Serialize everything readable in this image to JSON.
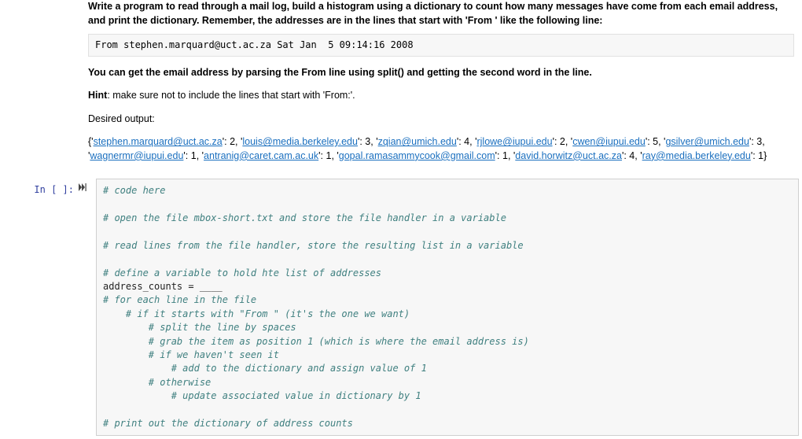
{
  "markdown": {
    "instruction_prefix_bold": "Write a program to read through a mail log, build a histogram using a dictionary to count how many messages have come from each email address, and print the dictionary. Remember, the addresses are in the lines that start with 'From ' like the following line:",
    "sample_line": "From stephen.marquard@uct.ac.za Sat Jan  5 09:14:16 2008",
    "parse_instruction": "You can get the email address by parsing the From line using split() and getting the second word in the line.",
    "hint_label": "Hint",
    "hint_text": ": make sure not to include the lines that start with 'From:'.",
    "desired_label": "Desired output:",
    "output_emails": [
      {
        "email": "stephen.marquard@uct.ac.za",
        "count": 2
      },
      {
        "email": "louis@media.berkeley.edu",
        "count": 3
      },
      {
        "email": "zqian@umich.edu",
        "count": 4
      },
      {
        "email": "rjlowe@iupui.edu",
        "count": 2
      },
      {
        "email": "cwen@iupui.edu",
        "count": 5
      },
      {
        "email": "gsilver@umich.edu",
        "count": 3
      },
      {
        "email": "wagnermr@iupui.edu",
        "count": 1
      },
      {
        "email": "antranig@caret.cam.ac.uk",
        "count": 1
      },
      {
        "email": "gopal.ramasammycook@gmail.com",
        "count": 1
      },
      {
        "email": "david.horwitz@uct.ac.za",
        "count": 4
      },
      {
        "email": "ray@media.berkeley.edu",
        "count": 1
      }
    ]
  },
  "cell": {
    "prompt": "In [ ]:",
    "lines": [
      {
        "t": "# code here",
        "cls": "c-comment"
      },
      {
        "t": "",
        "cls": ""
      },
      {
        "t": "# open the file mbox-short.txt and store the file handler in a variable",
        "cls": "c-comment"
      },
      {
        "t": "",
        "cls": ""
      },
      {
        "t": "# read lines from the file handler, store the resulting list in a variable",
        "cls": "c-comment"
      },
      {
        "t": "",
        "cls": ""
      },
      {
        "t": "# define a variable to hold hte list of addresses",
        "cls": "c-comment"
      },
      {
        "t": "address_counts = ____",
        "cls": "c-var"
      },
      {
        "t": "# for each line in the file",
        "cls": "c-comment"
      },
      {
        "t": "    # if it starts with \"From \" (it's the one we want)",
        "cls": "c-comment"
      },
      {
        "t": "        # split the line by spaces",
        "cls": "c-comment"
      },
      {
        "t": "        # grab the item as position 1 (which is where the email address is)",
        "cls": "c-comment"
      },
      {
        "t": "        # if we haven't seen it",
        "cls": "c-comment"
      },
      {
        "t": "            # add to the dictionary and assign value of 1",
        "cls": "c-comment"
      },
      {
        "t": "        # otherwise",
        "cls": "c-comment"
      },
      {
        "t": "            # update associated value in dictionary by 1",
        "cls": "c-comment"
      },
      {
        "t": "",
        "cls": ""
      },
      {
        "t": "# print out the dictionary of address counts",
        "cls": "c-comment"
      }
    ]
  }
}
